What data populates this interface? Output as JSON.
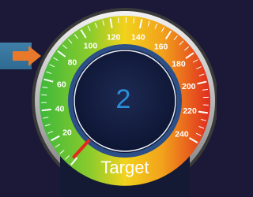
{
  "gauge": {
    "value": "2",
    "label": "Target",
    "min": 0,
    "max": 240,
    "tick_labels": [
      "20",
      "40",
      "60",
      "80",
      "100",
      "120",
      "140",
      "160",
      "180",
      "200",
      "220",
      "240"
    ],
    "zone_colors": {
      "green": "#3db83a",
      "yellow": "#f2d21c",
      "red": "#e02b1e"
    },
    "needle_color": "#e02b1e",
    "readout_color": "#2a8fd8"
  },
  "indicator": {
    "icon": "arrow-right-icon",
    "color": "#e8792a"
  }
}
